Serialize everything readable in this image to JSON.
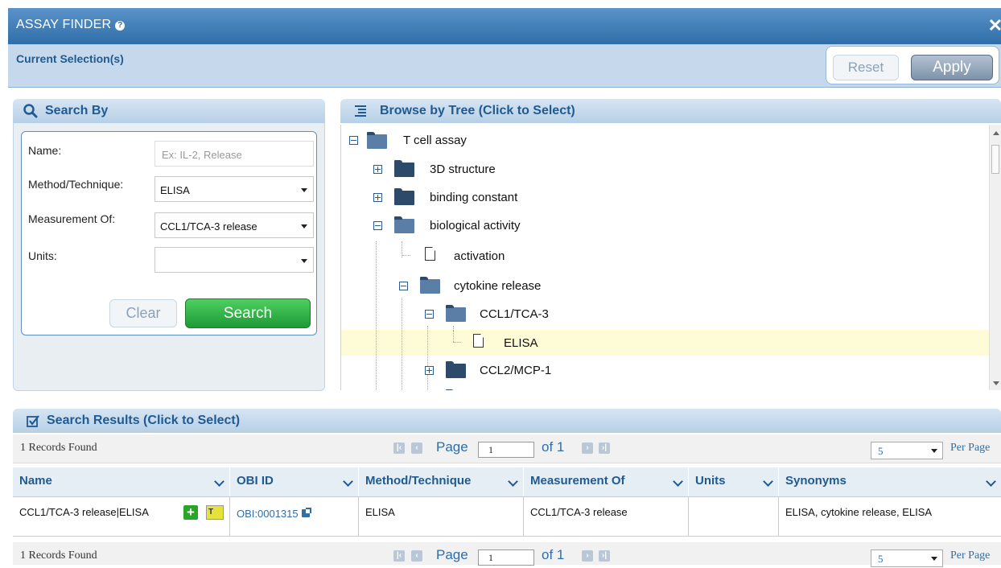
{
  "app": {
    "title": "ASSAY FINDER"
  },
  "current_selection": {
    "label": "Current Selection(s)",
    "reset_label": "Reset",
    "apply_label": "Apply"
  },
  "search_by": {
    "title": "Search By",
    "name_label": "Name:",
    "name_placeholder": "Ex: IL-2, Release",
    "method_label": "Method/Technique:",
    "method_value": "ELISA",
    "measurement_label": "Measurement Of:",
    "measurement_value": "CCL1/TCA-3 release",
    "units_label": "Units:",
    "units_value": "",
    "clear_label": "Clear",
    "search_label": "Search"
  },
  "tree": {
    "title": "Browse by Tree (Click to Select)",
    "nodes": [
      {
        "label": "T cell assay",
        "state": "expanded"
      },
      {
        "label": "3D structure",
        "state": "collapsed"
      },
      {
        "label": "binding constant",
        "state": "collapsed"
      },
      {
        "label": "biological activity",
        "state": "expanded"
      },
      {
        "label": "activation",
        "state": "leaf"
      },
      {
        "label": "cytokine release",
        "state": "expanded"
      },
      {
        "label": "CCL1/TCA-3",
        "state": "expanded"
      },
      {
        "label": "ELISA",
        "state": "leaf",
        "selected": true
      },
      {
        "label": "CCL2/MCP-1",
        "state": "collapsed"
      }
    ]
  },
  "results": {
    "title": "Search Results (Click to Select)",
    "records_found": "1 Records Found",
    "page_label": "Page",
    "page_value": "1",
    "of_label": "of 1",
    "per_page_value": "5",
    "per_page_label": "Per Page",
    "columns": [
      "Name",
      "OBI ID",
      "Method/Technique",
      "Measurement Of",
      "Units",
      "Synonyms"
    ],
    "rows": [
      {
        "name": "CCL1/TCA-3 release|ELISA",
        "obi_id": "OBI:0001315",
        "method": "ELISA",
        "measurement": "CCL1/TCA-3 release",
        "units": "",
        "synonyms": "ELISA, cytokine release, ELISA"
      }
    ]
  },
  "colors": {
    "header_blue": "#2f6ea8",
    "search_green": "#1e9a35",
    "highlight": "#fefbd7"
  }
}
